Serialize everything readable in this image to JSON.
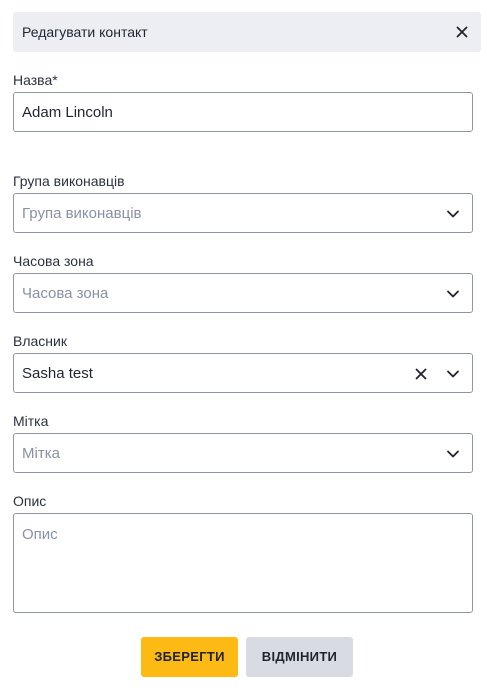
{
  "dialog": {
    "title": "Редагувати контакт"
  },
  "fields": {
    "name": {
      "label": "Назва*",
      "value": "Adam Lincoln"
    },
    "group": {
      "label": "Група виконавців",
      "placeholder": "Група виконавців"
    },
    "timezone": {
      "label": "Часова зона",
      "placeholder": "Часова зона"
    },
    "owner": {
      "label": "Власник",
      "value": "Sasha test"
    },
    "tag": {
      "label": "Мітка",
      "placeholder": "Мітка"
    },
    "description": {
      "label": "Опис",
      "placeholder": "Опис"
    }
  },
  "actions": {
    "save_label": "ЗБЕРЕГТИ",
    "cancel_label": "ВІДМІНИТИ"
  },
  "icons": {
    "close": "close-icon",
    "chevron": "chevron-down-icon",
    "clear": "clear-icon"
  },
  "colors": {
    "header_bg": "#eceef3",
    "primary": "#fdb914",
    "secondary": "#d8dbe2",
    "border": "#9096a3",
    "placeholder": "#8a90a6"
  }
}
